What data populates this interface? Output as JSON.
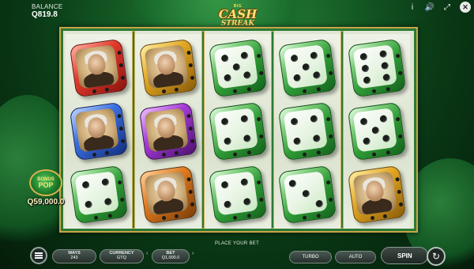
{
  "header": {
    "balance_label": "BALANCE",
    "balance_value": "Q819.8",
    "icons": [
      "info-icon",
      "sound-icon",
      "fullscreen-icon",
      "close-icon"
    ],
    "info_glyph": "i",
    "sound_glyph": "🔊",
    "fullscreen_glyph": "⤢",
    "close_glyph": "✕"
  },
  "logo": {
    "top": "BIG",
    "line1": "CASH",
    "line2": "STREAK"
  },
  "reels": [
    [
      "portrait-red",
      "portrait-blue",
      "dice-four-green"
    ],
    [
      "portrait-gold",
      "portrait-purple",
      "portrait-orange"
    ],
    [
      "dice-five-green",
      "dice-four-green",
      "dice-four-green"
    ],
    [
      "dice-five-green",
      "dice-four-green",
      "dice-three-green"
    ],
    [
      "dice-six-green",
      "dice-five-green",
      "portrait-gold"
    ]
  ],
  "bonus": {
    "title_top": "BONUS",
    "title_bottom": "POP",
    "value": "Q59,000.0"
  },
  "footer": {
    "place_your_bet": "PLACE YOUR BET",
    "ways_label": "WAYS",
    "ways_value": "243",
    "currency_label": "CURRENCY",
    "currency_value": "GTQ",
    "bet_label": "BET",
    "bet_value": "Q1,000.0",
    "turbo_label": "TURBO",
    "auto_label": "AUTO",
    "spin_label": "SPIN",
    "bet_decrease_glyph": "‹",
    "bet_increase_glyph": "›",
    "autoplay_glyph": "↻"
  },
  "colors": {
    "accent_gold": "#d9b34a",
    "board_green": "#2a7a36"
  }
}
